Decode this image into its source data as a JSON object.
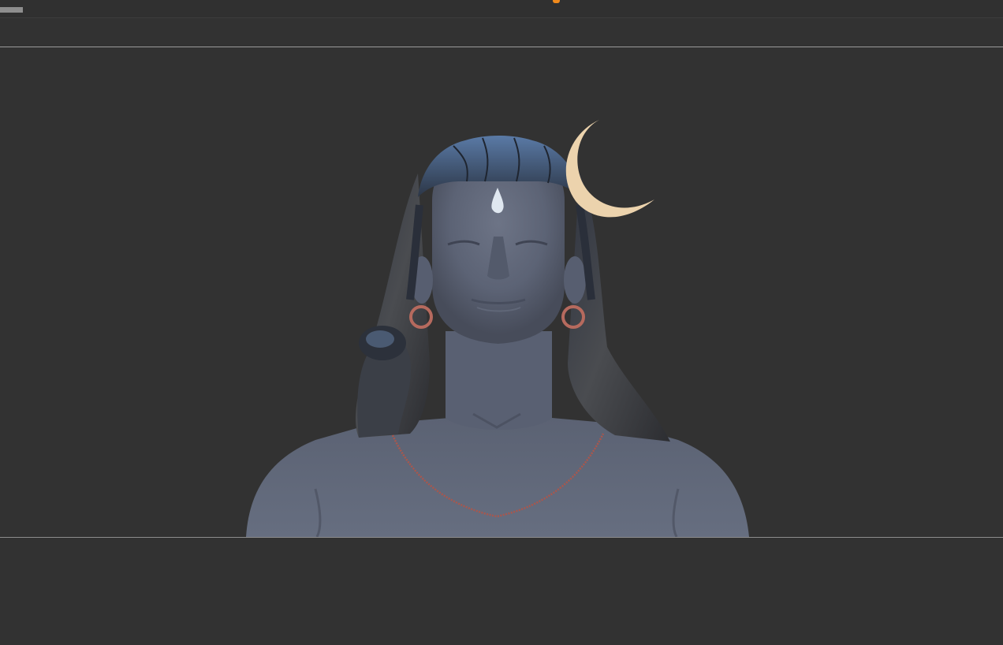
{
  "app": {
    "theme": {
      "background": "#333333",
      "accent": "#f08a1c",
      "divider": "#9b9b9b"
    },
    "canvas": {
      "model": "sculpt-bust",
      "palette": {
        "skin": "#5e6577",
        "hair": "#3a3c42",
        "crescent": "#ecd3ad",
        "tilak": "#dfe7f0",
        "earring": "#b66a5e",
        "necklace": "#a9574d"
      }
    }
  }
}
